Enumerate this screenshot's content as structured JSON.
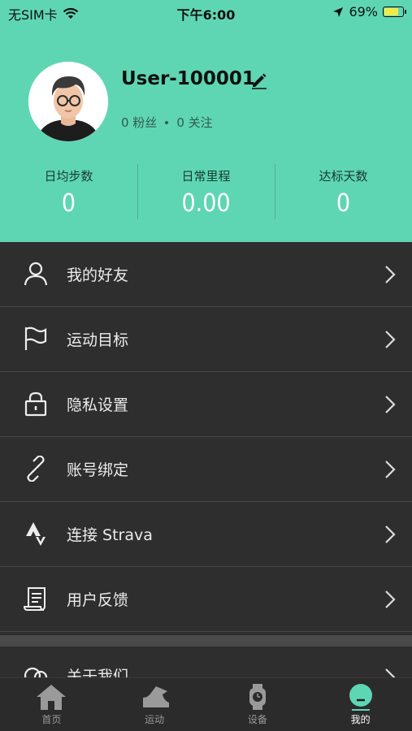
{
  "status_bar": {
    "carrier": "无SIM卡",
    "time": "下午6:00",
    "battery": "69%"
  },
  "profile": {
    "username": "User-100001",
    "fans": "0 粉丝",
    "following": "0 关注"
  },
  "stats": [
    {
      "label": "日均步数",
      "value": "0"
    },
    {
      "label": "日常里程",
      "value": "0.00"
    },
    {
      "label": "达标天数",
      "value": "0"
    }
  ],
  "menu": [
    {
      "label": "我的好友",
      "icon": "person-icon"
    },
    {
      "label": "运动目标",
      "icon": "flag-icon"
    },
    {
      "label": "隐私设置",
      "icon": "lock-icon"
    },
    {
      "label": "账号绑定",
      "icon": "link-icon"
    },
    {
      "label": "连接 Strava",
      "icon": "strava-icon"
    },
    {
      "label": "用户反馈",
      "icon": "feedback-icon"
    }
  ],
  "about": {
    "label": "关于我们"
  },
  "tabs": [
    {
      "label": "首页",
      "icon": "home-icon"
    },
    {
      "label": "运动",
      "icon": "shoe-icon"
    },
    {
      "label": "设备",
      "icon": "watch-icon"
    },
    {
      "label": "我的",
      "icon": "me-icon",
      "active": true
    }
  ],
  "colors": {
    "header_bg": "#5fd6b3",
    "menu_bg": "#2e2e2e",
    "accent": "#5fd6b3"
  }
}
